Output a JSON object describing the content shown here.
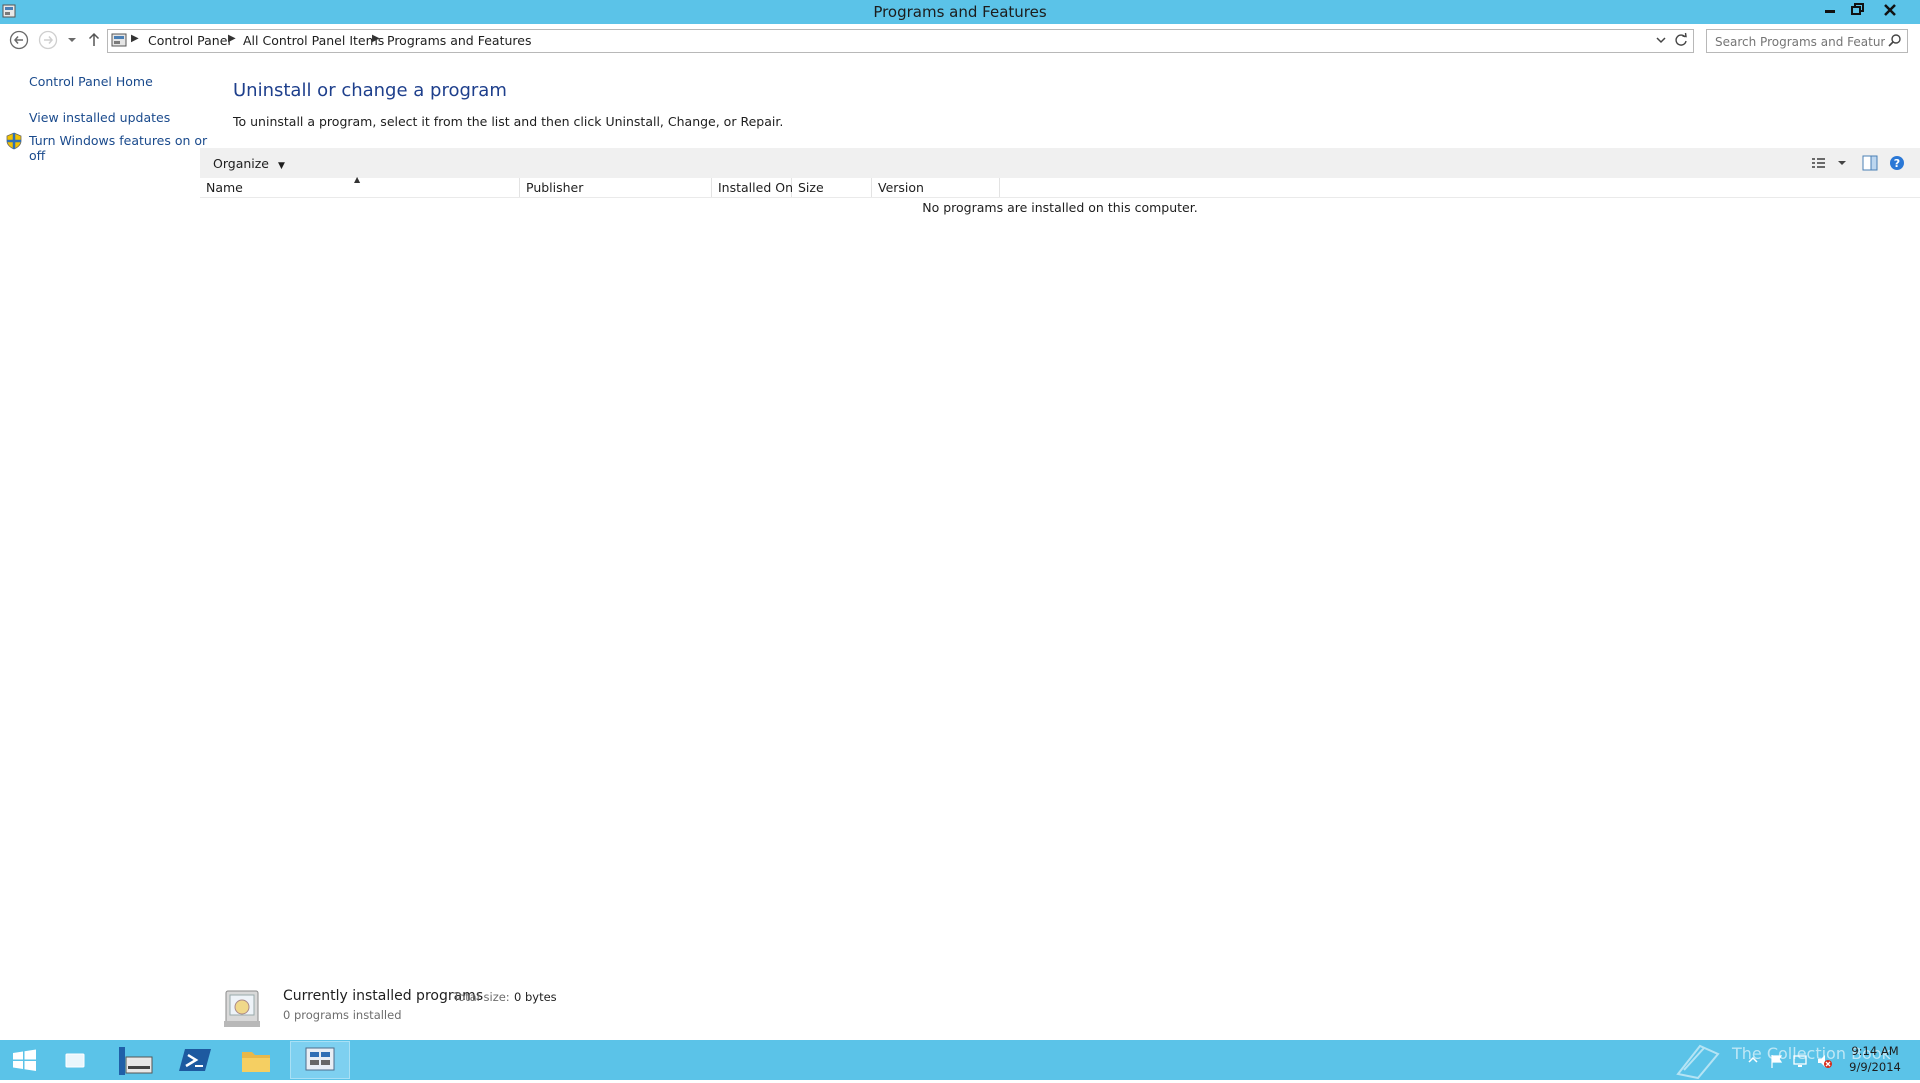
{
  "window": {
    "title": "Programs and Features"
  },
  "address": {
    "crumbs": [
      "Control Panel",
      "All Control Panel Items",
      "Programs and Features"
    ],
    "search_placeholder": "Search Programs and Features"
  },
  "sidebar": {
    "items": [
      {
        "label": "Control Panel Home"
      },
      {
        "label": "View installed updates"
      },
      {
        "label": "Turn Windows features on or",
        "label2": "off"
      }
    ]
  },
  "main": {
    "heading": "Uninstall or change a program",
    "instructions": "To uninstall a program, select it from the list and then click Uninstall, Change, or Repair.",
    "toolbar": {
      "organize_label": "Organize"
    },
    "columns": [
      "Name",
      "Publisher",
      "Installed On",
      "Size",
      "Version"
    ],
    "empty_message": "No programs are installed on this computer."
  },
  "details": {
    "title": "Currently installed programs",
    "total_size_label": "Total size:",
    "total_size_value": "0 bytes",
    "count": "0 programs installed"
  },
  "taskbar": {
    "watermark": "The Collection Book",
    "time": "9:14 AM",
    "date": "9/9/2014"
  },
  "colors": {
    "accent": "#5bc3e8",
    "link": "#1a4a8c",
    "heading": "#1e3f8c"
  }
}
